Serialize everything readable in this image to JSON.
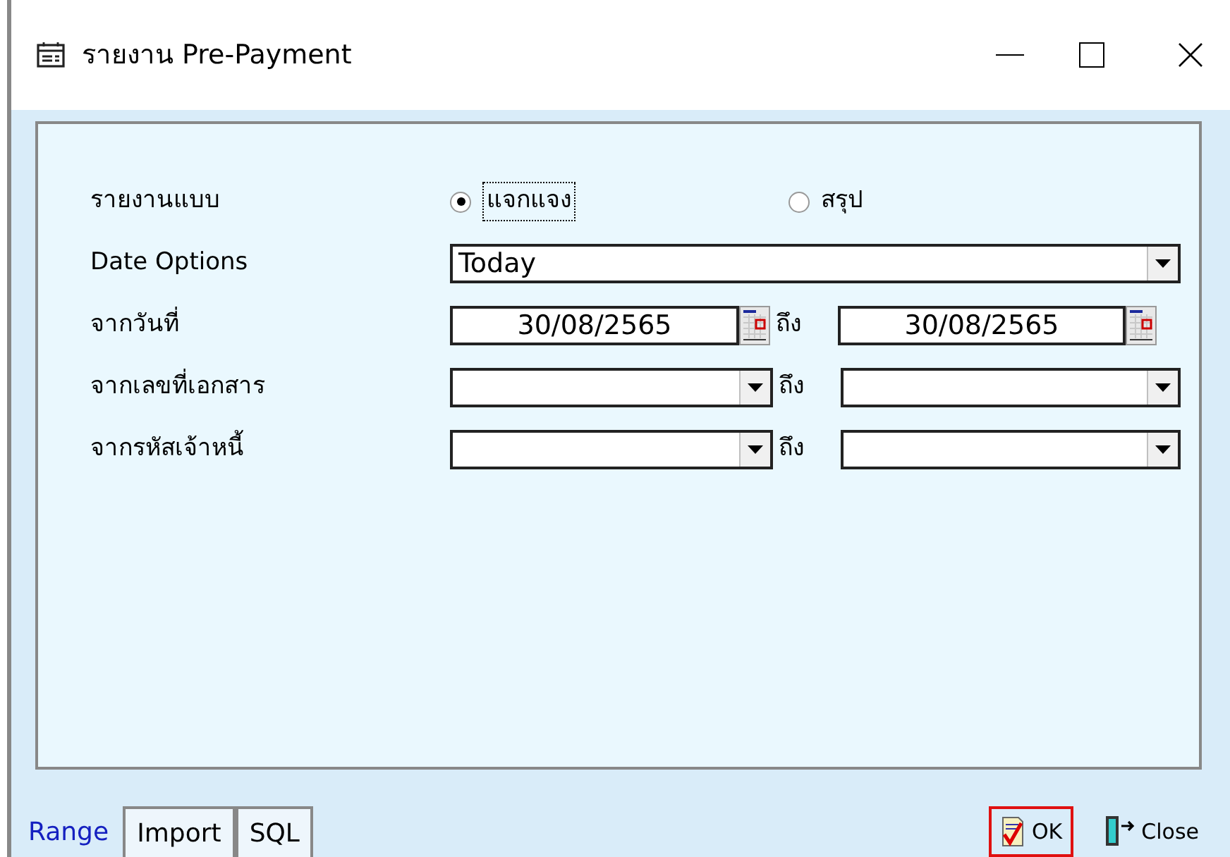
{
  "window": {
    "title": "รายงาน Pre-Payment"
  },
  "report_type": {
    "label": "รายงานแบบ",
    "options": [
      {
        "label": "แจกแจง",
        "selected": true
      },
      {
        "label": "สรุป",
        "selected": false
      }
    ]
  },
  "date_options": {
    "label": "Date Options",
    "value": "Today"
  },
  "rows": [
    {
      "label": "จากวันที่",
      "kind": "date",
      "from": "30/08/2565",
      "to_label": "ถึง",
      "to": "30/08/2565"
    },
    {
      "label": "จากเลขที่เอกสาร",
      "kind": "combo",
      "to_label": "ถึง"
    },
    {
      "label": "จากรหัสเจ้าหนี้",
      "kind": "combo",
      "to_label": "ถึง"
    }
  ],
  "tabs": [
    {
      "label": "Range",
      "selected": true
    },
    {
      "label": "Import",
      "selected": false
    },
    {
      "label": "SQL",
      "selected": false
    }
  ],
  "buttons": [
    {
      "label": "OK",
      "kind": "ok",
      "focused": true
    },
    {
      "label": "Close",
      "kind": "close",
      "focused": false
    }
  ]
}
